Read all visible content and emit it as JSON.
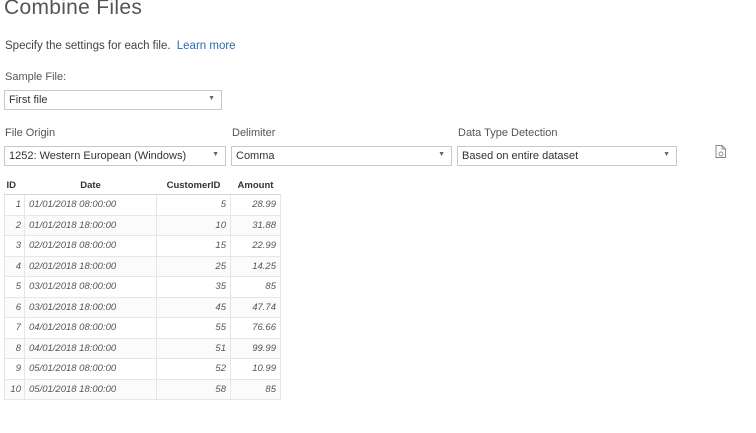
{
  "dialog": {
    "title": "Combine Files",
    "subtitle": "Specify the settings for each file.",
    "learn_more": "Learn more"
  },
  "sample_file": {
    "label": "Sample File:",
    "value": "First file"
  },
  "file_origin": {
    "label": "File Origin",
    "value": "1252: Western European (Windows)"
  },
  "delimiter": {
    "label": "Delimiter",
    "value": "Comma"
  },
  "data_type_detection": {
    "label": "Data Type Detection",
    "value": "Based on entire dataset"
  },
  "icons": {
    "dropdown": "chevron-down-icon",
    "refresh": "file-refresh-icon"
  },
  "table": {
    "headers": [
      "ID",
      "Date",
      "CustomerID",
      "Amount"
    ],
    "rows": [
      [
        "1",
        "01/01/2018 08:00:00",
        "5",
        "28.99"
      ],
      [
        "2",
        "01/01/2018 18:00:00",
        "10",
        "31.88"
      ],
      [
        "3",
        "02/01/2018 08:00:00",
        "15",
        "22.99"
      ],
      [
        "4",
        "02/01/2018 18:00:00",
        "25",
        "14.25"
      ],
      [
        "5",
        "03/01/2018 08:00:00",
        "35",
        "85"
      ],
      [
        "6",
        "03/01/2018 18:00:00",
        "45",
        "47.74"
      ],
      [
        "7",
        "04/01/2018 08:00:00",
        "55",
        "76.66"
      ],
      [
        "8",
        "04/01/2018 18:00:00",
        "51",
        "99.99"
      ],
      [
        "9",
        "05/01/2018 08:00:00",
        "52",
        "10.99"
      ],
      [
        "10",
        "05/01/2018 18:00:00",
        "58",
        "85"
      ]
    ]
  }
}
